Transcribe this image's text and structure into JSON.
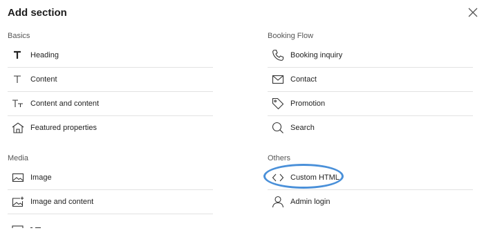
{
  "dialog": {
    "title": "Add section"
  },
  "basics": {
    "label": "Basics",
    "items": [
      {
        "label": "Heading",
        "icon": "heading-icon"
      },
      {
        "label": "Content",
        "icon": "text-icon"
      },
      {
        "label": "Content and content",
        "icon": "text-size-icon"
      },
      {
        "label": "Featured properties",
        "icon": "house-icon"
      }
    ]
  },
  "media": {
    "label": "Media",
    "items": [
      {
        "label": "Image",
        "icon": "image-icon"
      },
      {
        "label": "Image and content",
        "icon": "image-add-icon"
      }
    ]
  },
  "booking_flow": {
    "label": "Booking Flow",
    "items": [
      {
        "label": "Booking inquiry",
        "icon": "phone-icon"
      },
      {
        "label": "Contact",
        "icon": "mail-icon"
      },
      {
        "label": "Promotion",
        "icon": "tag-icon"
      },
      {
        "label": "Search",
        "icon": "search-icon"
      }
    ]
  },
  "others": {
    "label": "Others",
    "items": [
      {
        "label": "Custom HTML",
        "icon": "code-icon"
      },
      {
        "label": "Admin login",
        "icon": "user-icon"
      }
    ]
  },
  "colors": {
    "highlight": "#4a90d9",
    "divider": "#e2e2e2"
  }
}
